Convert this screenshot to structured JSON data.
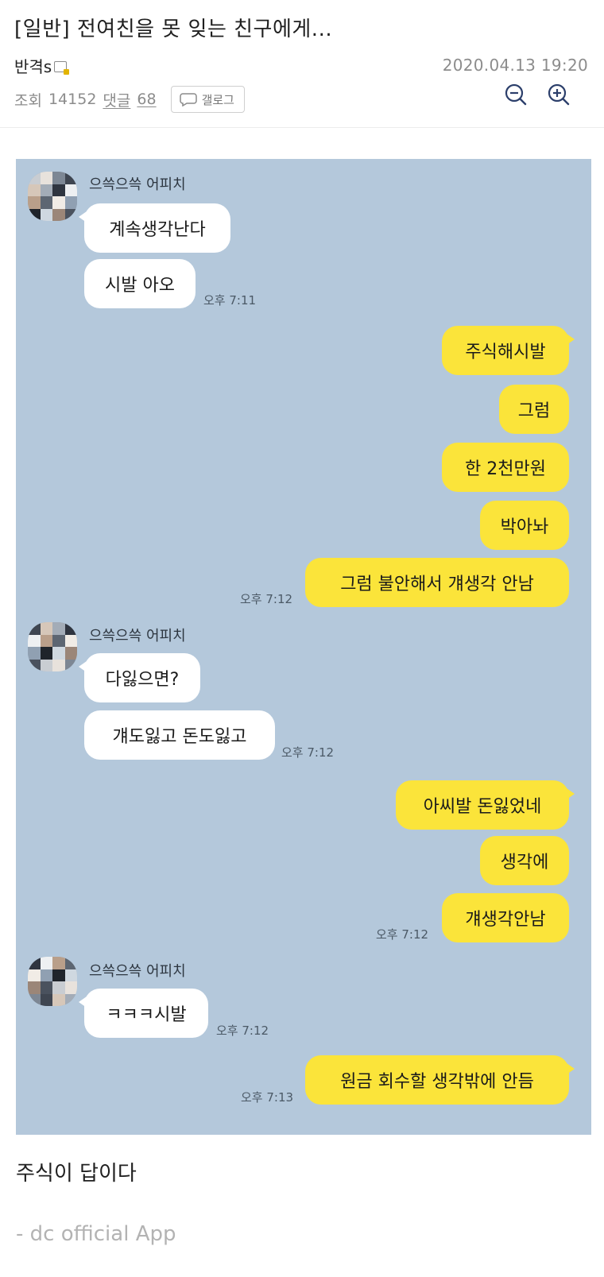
{
  "post": {
    "title": "[일반] 전여친을 못 잊는 친구에게...",
    "author": "반격s",
    "datetime": "2020.04.13 19:20",
    "views_label": "조회",
    "views": "14152",
    "comments_label": "댓글",
    "comments": "68",
    "gallog_label": "갤로그"
  },
  "chat": {
    "background": "#b4c8db",
    "sender_name": "으쓱으쓱 어피치",
    "groups": [
      {
        "messages": [
          "계속생각난다",
          "시발 아오"
        ],
        "time": "오후 7:11"
      },
      {
        "messages": [
          "주식해시발",
          "그럼",
          "한 2천만원",
          "박아놔",
          "그럼 불안해서 걔생각 안남"
        ],
        "time": "오후 7:12"
      },
      {
        "messages": [
          "다잃으면?",
          "걔도잃고 돈도잃고"
        ],
        "time": "오후 7:12"
      },
      {
        "messages": [
          "아씨발 돈잃었네",
          "생각에",
          "걔생각안남"
        ],
        "time": "오후 7:12"
      },
      {
        "messages": [
          "ㅋㅋㅋ시발"
        ],
        "time": "오후 7:12"
      },
      {
        "messages": [
          "원금 회수할 생각밖에 안듬"
        ],
        "time": "오후 7:13"
      }
    ]
  },
  "caption": "주식이 답이다",
  "footer": "- dc official App",
  "colors": {
    "outgoing_bubble": "#fbe43a",
    "incoming_bubble": "#ffffff",
    "meta_text": "#8c8c8c"
  }
}
